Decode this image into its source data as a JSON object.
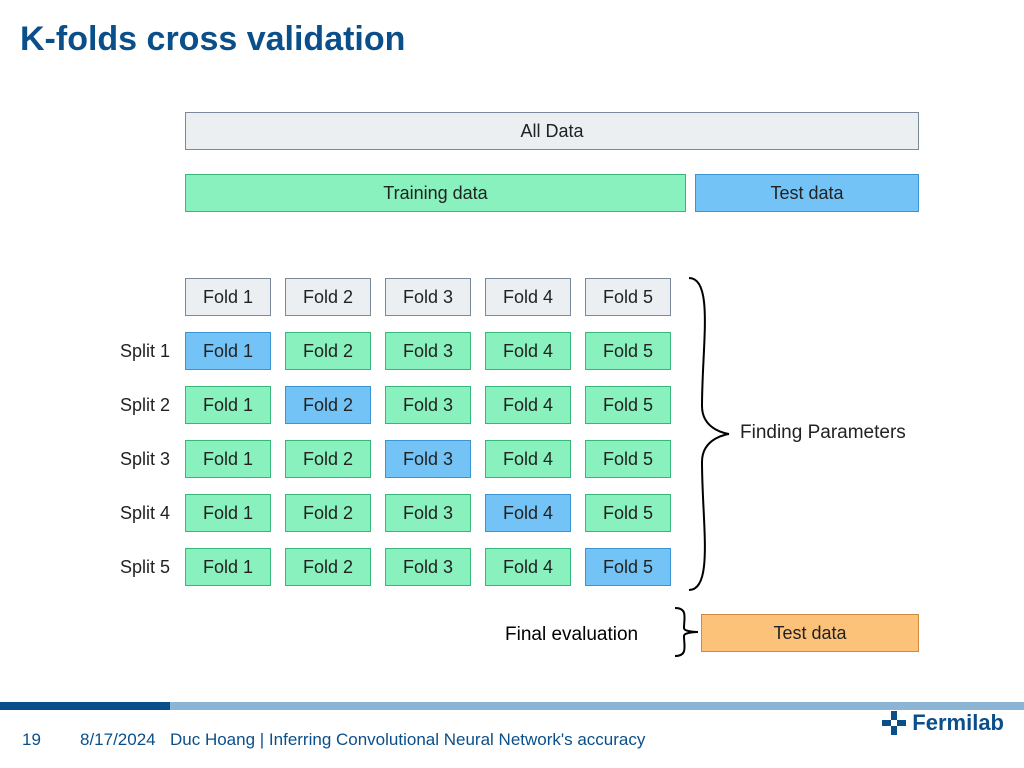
{
  "title": "K-folds cross validation",
  "alldata": "All Data",
  "training": "Training data",
  "testdata": "Test data",
  "folds_header": [
    "Fold 1",
    "Fold 2",
    "Fold 3",
    "Fold 4",
    "Fold 5"
  ],
  "splits": [
    {
      "label": "Split 1",
      "folds": [
        "Fold 1",
        "Fold 2",
        "Fold 3",
        "Fold 4",
        "Fold 5"
      ],
      "hold": 0
    },
    {
      "label": "Split 2",
      "folds": [
        "Fold 1",
        "Fold 2",
        "Fold 3",
        "Fold 4",
        "Fold 5"
      ],
      "hold": 1
    },
    {
      "label": "Split 3",
      "folds": [
        "Fold 1",
        "Fold 2",
        "Fold 3",
        "Fold 4",
        "Fold 5"
      ],
      "hold": 2
    },
    {
      "label": "Split 4",
      "folds": [
        "Fold 1",
        "Fold 2",
        "Fold 3",
        "Fold 4",
        "Fold 5"
      ],
      "hold": 3
    },
    {
      "label": "Split 5",
      "folds": [
        "Fold 1",
        "Fold 2",
        "Fold 3",
        "Fold 4",
        "Fold 5"
      ],
      "hold": 4
    }
  ],
  "annotation_right": "Finding Parameters",
  "final_eval": "Final evaluation",
  "final_testdata": "Test data",
  "footer": {
    "page": "19",
    "date": "8/17/2024",
    "byline": "Duc Hoang | Inferring Convolutional Neural Network's accuracy",
    "logo": "Fermilab"
  }
}
